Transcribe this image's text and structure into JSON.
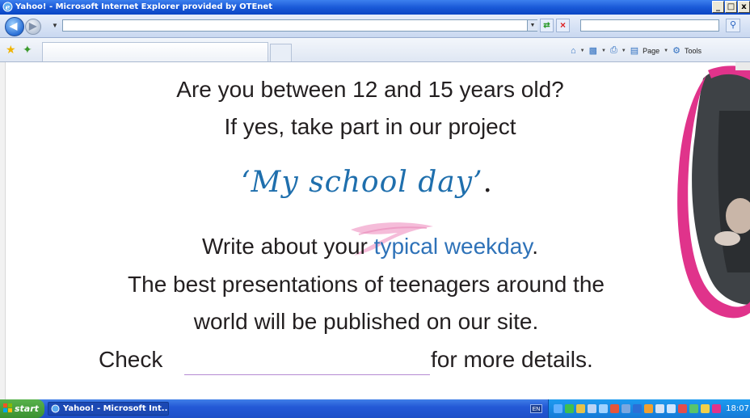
{
  "window": {
    "title": "Yahoo! - Microsoft Internet Explorer provided by OTEnet",
    "controls": {
      "minimize": "_",
      "maximize": "□",
      "close": "x"
    }
  },
  "address_bar": {
    "url": "",
    "search_placeholder": ""
  },
  "command_bar": {
    "page_label": "Page",
    "tools_label": "Tools"
  },
  "content": {
    "line1": "Are you between 12 and 15 years old?",
    "line2": "If yes, take part in our project",
    "project_title": "‘My school day’",
    "project_end": ".",
    "line3_pre": "Write about your ",
    "line3_highlight": "typical weekday",
    "line3_post": ".",
    "line4": "The best presentations of teenagers around the",
    "line5": "world will be published on our site.",
    "check_label": "Check",
    "details_label": "for more details."
  },
  "taskbar": {
    "start_label": "start",
    "task_label": "Yahoo! - Microsoft Int...",
    "language": "EN",
    "clock": "18:07"
  },
  "colors": {
    "accent_blue": "#2e72b8",
    "title_blue": "#1f6fad",
    "brush_pink": "#e0338b",
    "text": "#231f20"
  },
  "icons": {
    "ie": "ie-logo-icon",
    "back": "back-arrow-icon",
    "forward": "forward-arrow-icon",
    "refresh": "refresh-icon",
    "stop": "stop-icon",
    "search": "search-icon",
    "favorites": "favorites-star-icon",
    "add_favorite": "add-favorite-icon",
    "home": "home-icon",
    "feeds": "feeds-icon",
    "print": "print-icon",
    "page": "page-icon",
    "tools": "tools-gear-icon"
  }
}
